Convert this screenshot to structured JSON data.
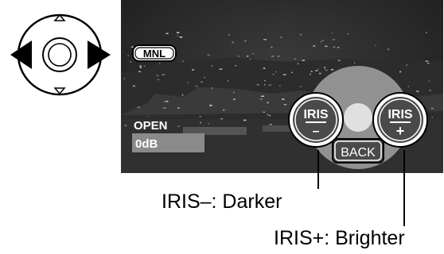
{
  "pad": {
    "left_arrow_icon": "left-arrow-icon",
    "right_arrow_icon": "right-arrow-icon",
    "up_arrow_icon": "up-arrow-icon",
    "down_arrow_icon": "down-arrow-icon"
  },
  "screen": {
    "mode_badge": "MNL",
    "iris_value": "OPEN",
    "gain_value": "0dB",
    "buttons": {
      "iris_minus": {
        "label": "IRIS",
        "sign": "–"
      },
      "iris_plus": {
        "label": "IRIS",
        "sign": "+"
      },
      "back": "BACK"
    }
  },
  "captions": {
    "darker": "IRIS–: Darker",
    "brighter": "IRIS+: Brighter"
  },
  "colors": {
    "screen_bg": "#252525",
    "ring_fill": "#9a9a9a",
    "button_fill": "#4a4a4a",
    "gain_bar": "#8a8a8a"
  }
}
